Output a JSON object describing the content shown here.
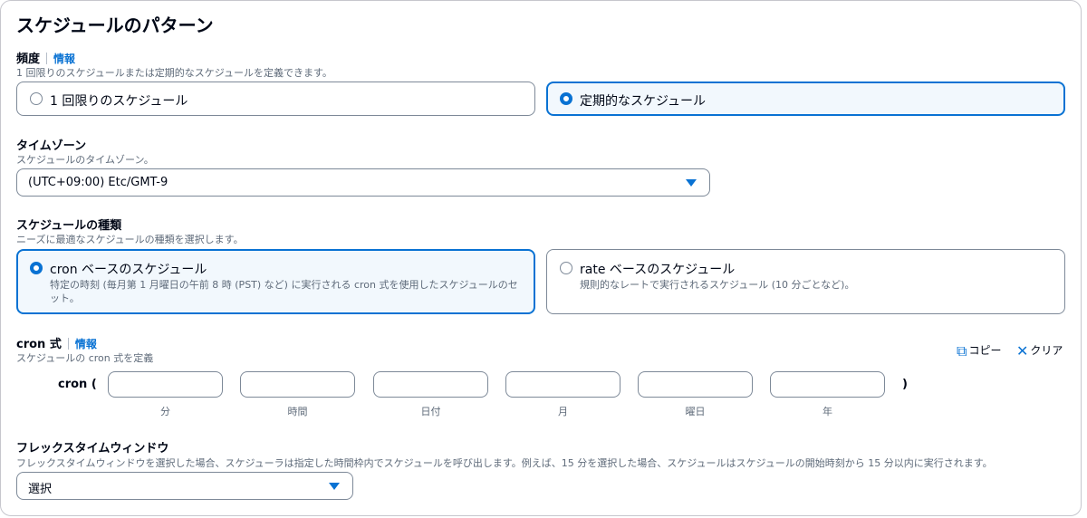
{
  "title": "スケジュールのパターン",
  "frequency": {
    "label": "頻度",
    "info": "情報",
    "description": "1 回限りのスケジュールまたは定期的なスケジュールを定義できます。",
    "options": [
      {
        "label": "1 回限りのスケジュール",
        "selected": false
      },
      {
        "label": "定期的なスケジュール",
        "selected": true
      }
    ]
  },
  "timezone": {
    "label": "タイムゾーン",
    "description": "スケジュールのタイムゾーン。",
    "value": "(UTC+09:00) Etc/GMT-9"
  },
  "schedule_type": {
    "label": "スケジュールの種類",
    "description": "ニーズに最適なスケジュールの種類を選択します。",
    "options": [
      {
        "label": "cron ベースのスケジュール",
        "sub": "特定の時刻 (毎月第 1 月曜日の午前 8 時 (PST) など) に実行される cron 式を使用したスケジュールのセット。",
        "selected": true
      },
      {
        "label": "rate ベースのスケジュール",
        "sub": "規則的なレートで実行されるスケジュール (10 分ごとなど)。",
        "selected": false
      }
    ]
  },
  "cron": {
    "label": "cron 式",
    "info": "情報",
    "description": "スケジュールの cron 式を定義",
    "copy": "コピー",
    "clear": "クリア",
    "prefix": "cron (",
    "suffix": ")",
    "fields": [
      {
        "label": "分",
        "value": ""
      },
      {
        "label": "時間",
        "value": ""
      },
      {
        "label": "日付",
        "value": ""
      },
      {
        "label": "月",
        "value": ""
      },
      {
        "label": "曜日",
        "value": ""
      },
      {
        "label": "年",
        "value": ""
      }
    ]
  },
  "flex": {
    "label": "フレックスタイムウィンドウ",
    "description": "フレックスタイムウィンドウを選択した場合、スケジューラは指定した時間枠内でスケジュールを呼び出します。例えば、15 分を選択した場合、スケジュールはスケジュールの開始時刻から 15 分以内に実行されます。",
    "value": "選択"
  },
  "colors": {
    "accent": "#0972d3",
    "selected_bg": "#f2f8fd",
    "border": "#7d8998"
  }
}
